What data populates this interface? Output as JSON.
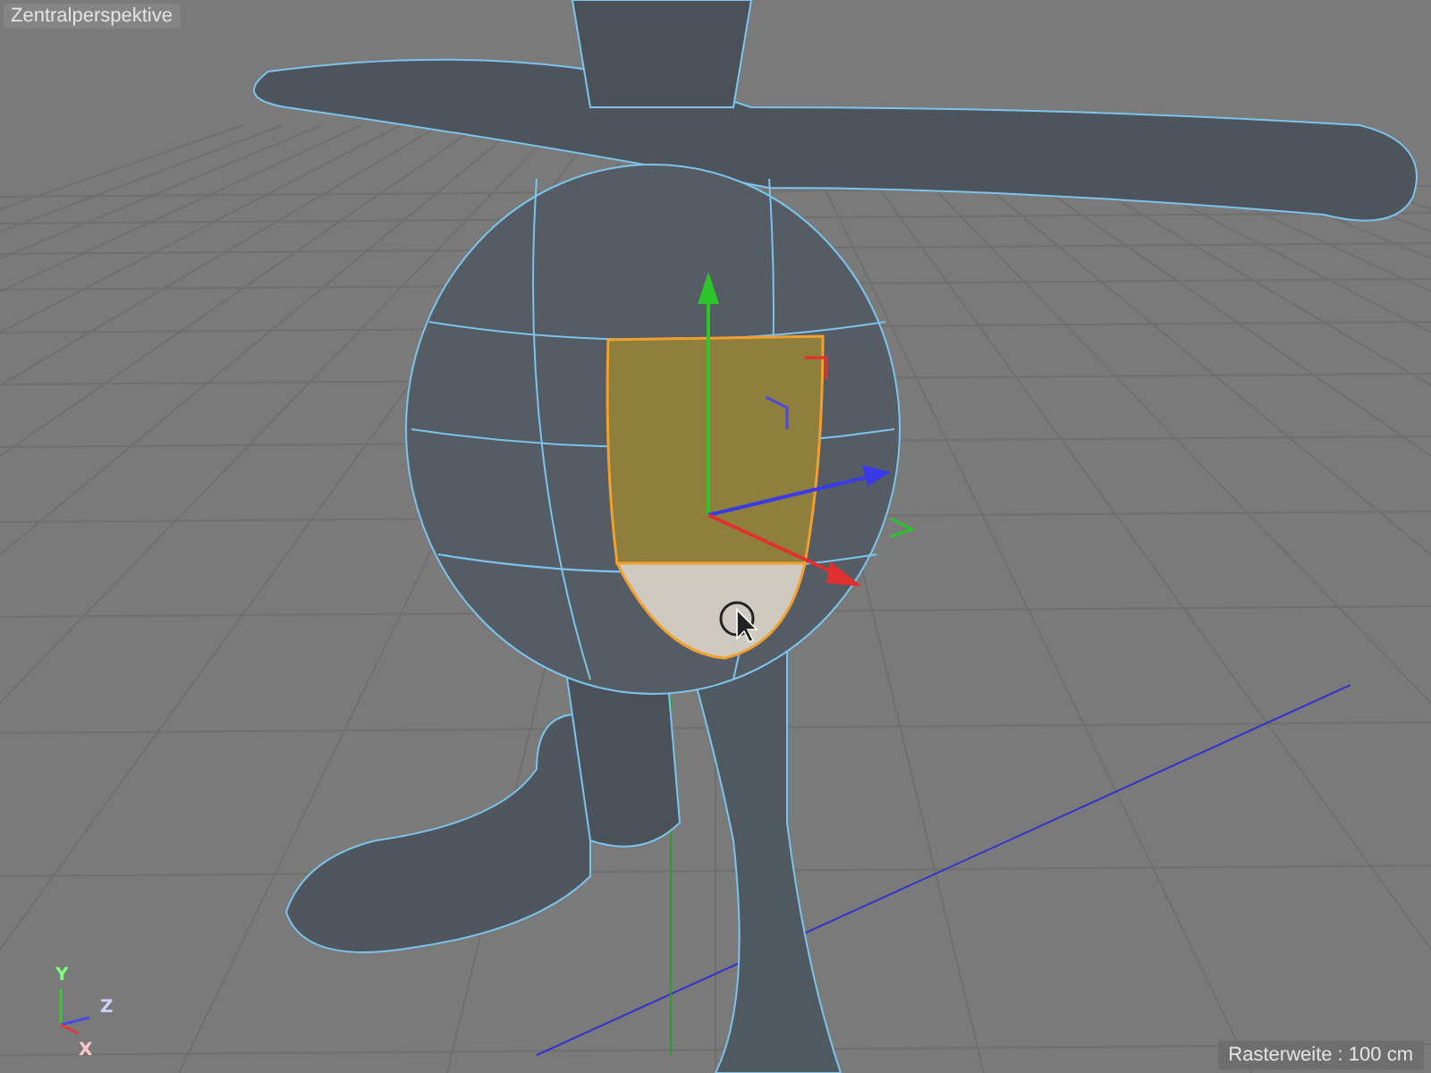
{
  "viewport": {
    "camera_label": "Zentralperspektive",
    "grid_size_label": "Rasterweite : 100 cm",
    "axis_labels": [
      "Y",
      "Z",
      "X"
    ]
  }
}
